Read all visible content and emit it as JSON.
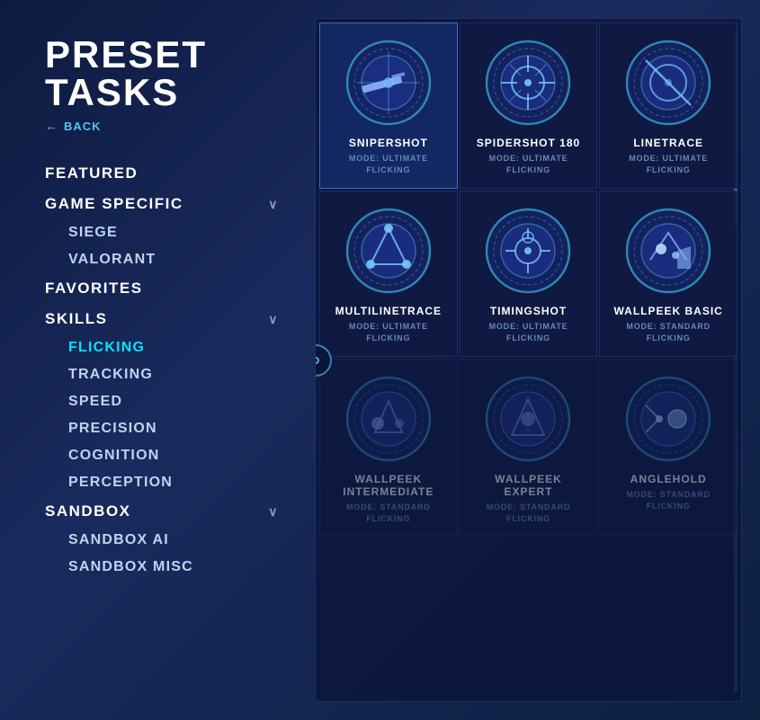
{
  "page": {
    "title": "PRESET TASKS",
    "back_label": "BACK"
  },
  "sidebar": {
    "nav_items": [
      {
        "id": "featured",
        "label": "FEATURED",
        "type": "main",
        "has_chevron": false
      },
      {
        "id": "game_specific",
        "label": "GAME SPECIFIC",
        "type": "main",
        "has_chevron": true
      },
      {
        "id": "siege",
        "label": "SIEGE",
        "type": "sub"
      },
      {
        "id": "valorant",
        "label": "VALORANT",
        "type": "sub"
      },
      {
        "id": "favorites",
        "label": "FAVORITES",
        "type": "main",
        "has_chevron": false
      },
      {
        "id": "skills",
        "label": "SKILLS",
        "type": "main",
        "has_chevron": true
      },
      {
        "id": "flicking",
        "label": "FLICKING",
        "type": "sub",
        "active": true
      },
      {
        "id": "tracking",
        "label": "TRACKING",
        "type": "sub"
      },
      {
        "id": "speed",
        "label": "SPEED",
        "type": "sub"
      },
      {
        "id": "precision",
        "label": "PRECISION",
        "type": "sub"
      },
      {
        "id": "cognition",
        "label": "COGNITION",
        "type": "sub"
      },
      {
        "id": "perception",
        "label": "PERCEPTION",
        "type": "sub"
      },
      {
        "id": "sandbox",
        "label": "SANDBOX",
        "type": "main",
        "has_chevron": true
      },
      {
        "id": "sandbox_ai",
        "label": "SANDBOX AI",
        "type": "sub"
      },
      {
        "id": "sandbox_misc",
        "label": "SANDBOX MISC",
        "type": "sub"
      }
    ]
  },
  "tasks": [
    {
      "id": "snipershot",
      "name": "SNIPERSHOT",
      "mode_line1": "MODE: ULTIMATE",
      "mode_line2": "FLICKING",
      "icon_type": "sniper",
      "selected": true
    },
    {
      "id": "spidershot_180",
      "name": "SPIDERSHOT 180",
      "mode_line1": "MODE: ULTIMATE",
      "mode_line2": "FLICKING",
      "icon_type": "crosshair",
      "selected": false
    },
    {
      "id": "linetrace",
      "name": "LINETRACE",
      "mode_line1": "MODE: ULTIMATE",
      "mode_line2": "FLICKING",
      "icon_type": "circle_slash",
      "selected": false
    },
    {
      "id": "multilinetrace",
      "name": "MULTILINETRACE",
      "mode_line1": "MODE: ULTIMATE",
      "mode_line2": "FLICKING",
      "icon_type": "triangle_dots",
      "selected": false
    },
    {
      "id": "timingshot",
      "name": "TIMINGSHOT",
      "mode_line1": "MODE: ULTIMATE",
      "mode_line2": "FLICKING",
      "icon_type": "crosshair2",
      "selected": false
    },
    {
      "id": "wallpeek_basic",
      "name": "WALLPEEK BASIC",
      "mode_line1": "MODE: STANDARD",
      "mode_line2": "FLICKING",
      "icon_type": "wallpeek",
      "selected": false
    },
    {
      "id": "wallpeek_intermediate",
      "name": "WALLPEEK INTERMEDIATE",
      "mode_line1": "MODE: STANDARD",
      "mode_line2": "FLICKING",
      "icon_type": "wallpeek2",
      "selected": false,
      "dimmed": true
    },
    {
      "id": "wallpeek_expert",
      "name": "WALLPEEK EXPERT",
      "mode_line1": "MODE: STANDARD",
      "mode_line2": "FLICKING",
      "icon_type": "wallpeek3",
      "selected": false,
      "dimmed": true
    },
    {
      "id": "anglehold",
      "name": "ANGLEHOLD",
      "mode_line1": "MODE: STANDARD",
      "mode_line2": "FLICKING",
      "icon_type": "anglehold",
      "selected": false,
      "dimmed": true
    }
  ]
}
